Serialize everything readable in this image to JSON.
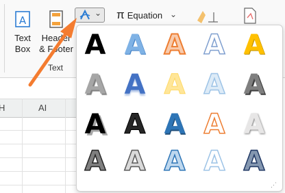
{
  "ribbon": {
    "text_box_line1": "Text",
    "text_box_line2": "Box",
    "header_footer_line1": "Header",
    "header_footer_line2": "& Footer",
    "group_label": "Text",
    "wordart_chevron": "⌄",
    "equation_symbol": "π",
    "equation_label": "Equation",
    "equation_chevron": "⌄"
  },
  "sheet": {
    "col_h": "H",
    "col_ai": "AI"
  },
  "wordart": {
    "glyph": "A",
    "styles": [
      {
        "name": "fill-black",
        "color": "#000000"
      },
      {
        "name": "fill-blue-gradient",
        "color": "#5b9bd5"
      },
      {
        "name": "fill-orange-outline",
        "color": "#f4b183"
      },
      {
        "name": "outline-blue-white",
        "color": "#ffffff"
      },
      {
        "name": "fill-gold-gradient",
        "color": "#ffc000"
      },
      {
        "name": "fill-gray-shadow",
        "color": "#8c8c8c"
      },
      {
        "name": "fill-blue-reflection",
        "color": "#4472c4"
      },
      {
        "name": "fill-light-gold",
        "color": "#ffe699"
      },
      {
        "name": "outline-light-blue",
        "color": "#ddebf7"
      },
      {
        "name": "fill-gray-bevel",
        "color": "#7f7f7f"
      },
      {
        "name": "fill-black-shadow",
        "color": "#000000"
      },
      {
        "name": "fill-dark-outline",
        "color": "#262626"
      },
      {
        "name": "fill-blue-bold",
        "color": "#2e75b6"
      },
      {
        "name": "outline-orange",
        "color": "#ffffff"
      },
      {
        "name": "fill-white-gray",
        "color": "#d9d9d9"
      },
      {
        "name": "pattern-gray",
        "color": "#595959"
      },
      {
        "name": "pattern-light-gray",
        "color": "#a6a6a6"
      },
      {
        "name": "pattern-blue",
        "color": "#5b9bd5"
      },
      {
        "name": "pattern-light-blue",
        "color": "#9dc3e6"
      },
      {
        "name": "pattern-navy",
        "color": "#203864"
      }
    ]
  },
  "icons": {
    "text_box_icon": "text-box",
    "header_footer_icon": "header-footer",
    "wordart_icon": "wordart",
    "signature_icon": "signature-line",
    "object_icon": "object"
  },
  "colors": {
    "accent_blue": "#2b7cd3",
    "annotation_arrow": "#f47c30"
  }
}
